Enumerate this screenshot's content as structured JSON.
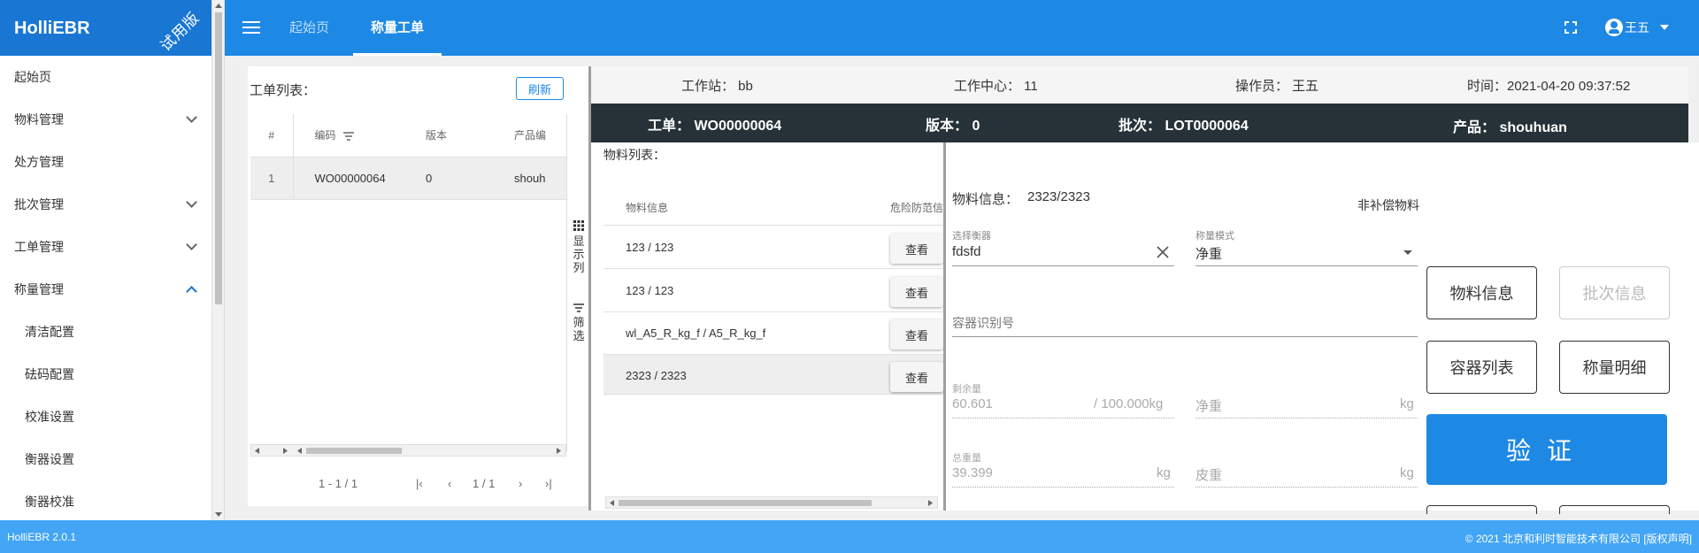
{
  "brand": {
    "name": "HolliEBR",
    "ribbon": "试用版"
  },
  "sidebar": {
    "items": [
      {
        "label": "起始页",
        "expandable": false
      },
      {
        "label": "物料管理",
        "expandable": true
      },
      {
        "label": "处方管理",
        "expandable": false
      },
      {
        "label": "批次管理",
        "expandable": true
      },
      {
        "label": "工单管理",
        "expandable": true
      },
      {
        "label": "称量管理",
        "expandable": true,
        "expanded": true
      }
    ],
    "subitems": [
      "清洁配置",
      "砝码配置",
      "校准设置",
      "衡器设置",
      "衡器校准"
    ]
  },
  "topbar": {
    "tabs": [
      "起始页",
      "称量工单"
    ],
    "active_tab": "称量工单",
    "user": "王五"
  },
  "workorders": {
    "title": "工单列表：",
    "refresh": "刷新",
    "columns": [
      "#",
      "编码",
      "版本",
      "产品编"
    ],
    "rows": [
      {
        "idx": "1",
        "code": "WO00000064",
        "version": "0",
        "product": "shouh"
      }
    ],
    "tools": [
      "显示列",
      "筛选"
    ],
    "pager": {
      "range": "1 - 1 / 1",
      "page": "1 / 1"
    }
  },
  "station_info": {
    "workstation": "工作站： bb",
    "center": "工作中心： 11",
    "operator": "操作员： 王五",
    "time": "时间：2021-04-20 09:37:52"
  },
  "order_bar": {
    "order": "工单： WO00000064",
    "version": "版本： 0",
    "batch": "批次： LOT0000064",
    "product": "产品： shouhuan"
  },
  "materials": {
    "title": "物料列表：",
    "col_info": "物料信息",
    "col_danger": "危险防范信",
    "view_label": "查看",
    "rows": [
      "123 / 123",
      "123 / 123",
      "wl_A5_R_kg_f / A5_R_kg_f",
      "2323 / 2323"
    ],
    "selected_index": 3
  },
  "weighing": {
    "material_info_label": "物料信息：",
    "material_info_value": "2323/2323",
    "non_comp": "非补偿物料",
    "scale_label": "选择衡器",
    "scale_value": "fdsfd",
    "mode_label": "称量模式",
    "mode_value": "净重",
    "container_placeholder": "容器识别号",
    "remaining_label": "剩余量",
    "remaining_value": "60.601",
    "remaining_total": "/ 100.000kg",
    "net_label": "净重",
    "net_unit": "kg",
    "total_label": "总重量",
    "total_value": "39.399",
    "total_unit": "kg",
    "tare_label": "皮重",
    "tare_unit": "kg",
    "buttons": {
      "material_info": "物料信息",
      "batch_info": "批次信息",
      "container_list": "容器列表",
      "weigh_detail": "称量明细",
      "verify": "验证"
    }
  },
  "footer": {
    "version": "HolliEBR 2.0.1",
    "copyright": "© 2021  北京和利时智能技术有限公司 [版权声明]"
  },
  "colors": {
    "primary": "#1976d2",
    "topbar": "#1e88e5",
    "footer": "#42a5f5",
    "dark_bar": "#263238"
  }
}
